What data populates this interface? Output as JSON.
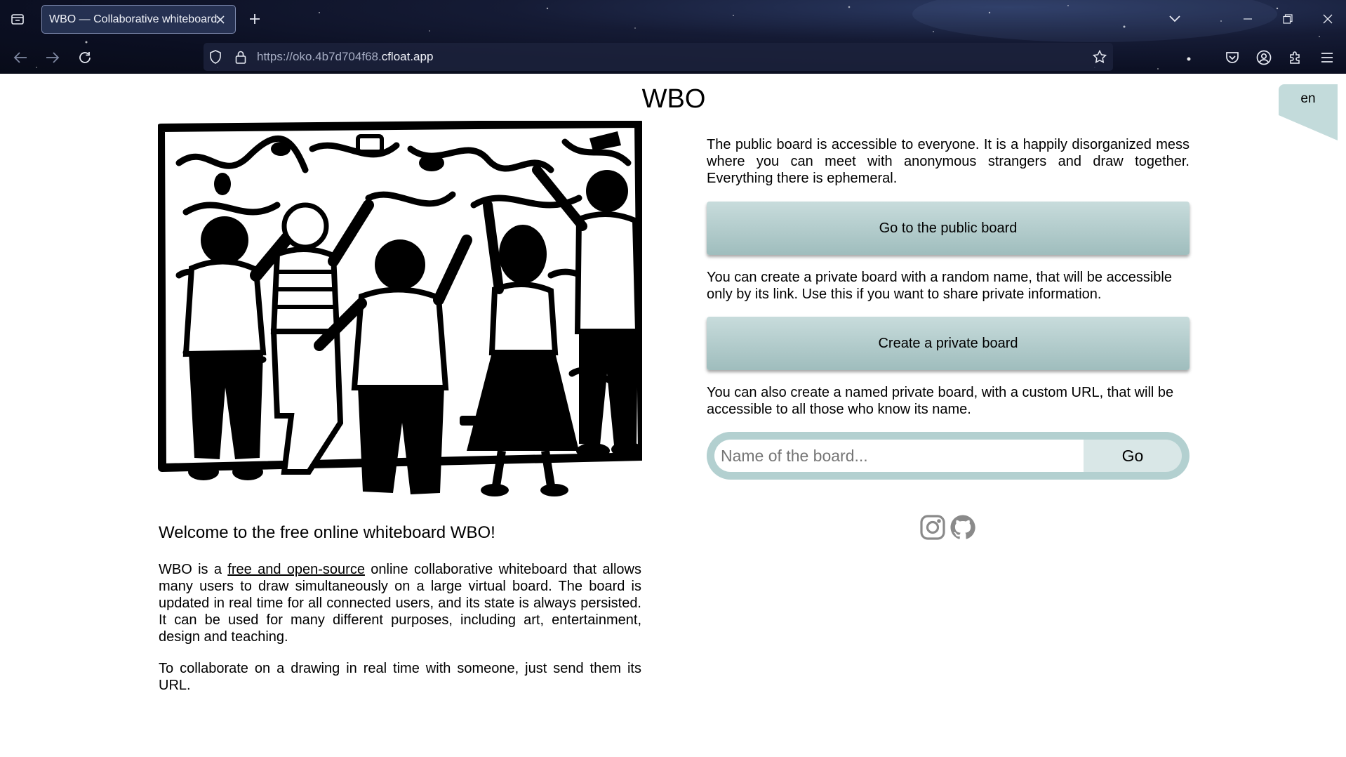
{
  "browser": {
    "tab": {
      "title": "WBO — Collaborative whiteboard"
    },
    "url": {
      "prefix": "https://oko.4b7d704f68.",
      "host": "cfloat.app"
    },
    "icons": {
      "tab_list": "tab-list-icon",
      "tab_close": "close-icon",
      "new_tab": "plus-icon",
      "back": "arrow-left-icon",
      "forward": "arrow-right-icon",
      "reload": "reload-icon",
      "shield": "shield-icon",
      "lock": "lock-icon",
      "bookmark": "star-icon",
      "pocket": "pocket-icon",
      "account": "account-icon",
      "extensions": "puzzle-icon",
      "menu": "hamburger-icon",
      "list_all_tabs": "chevron-down-icon",
      "minimize": "minimize-icon",
      "restore": "restore-icon",
      "close_window": "close-icon"
    }
  },
  "page": {
    "title": "WBO",
    "language": "en",
    "welcome": "Welcome to the free online whiteboard WBO!",
    "intro": {
      "before": "WBO is a ",
      "link": "free and open-source",
      "after": " online collaborative whiteboard that allows many users to draw simultaneously on a large virtual board. The board is updated in real time for all connected users, and its state is always persisted. It can be used for many different purposes, including art, entertainment, design and teaching."
    },
    "collab": "To collaborate on a drawing in real time with someone, just send them its URL.",
    "public_board": {
      "description": "The public board is accessible to everyone. It is a happily disorganized mess where you can meet with anonymous strangers and draw together. Everything there is ephemeral.",
      "button": "Go to the public board"
    },
    "private_board": {
      "description": "You can create a private board with a random name, that will be accessible only by its link. Use this if you want to share private information.",
      "button": "Create a private board"
    },
    "named_board": {
      "description": "You can also create a named private board, with a custom URL, that will be accessible to all those who know its name.",
      "placeholder": "Name of the board...",
      "button": "Go"
    },
    "social": [
      "instagram-icon",
      "github-icon"
    ],
    "colors": {
      "button": "#b3d0d0",
      "lang_tab": "#c3dbdb",
      "icon_gray": "#8a8a8a"
    }
  }
}
